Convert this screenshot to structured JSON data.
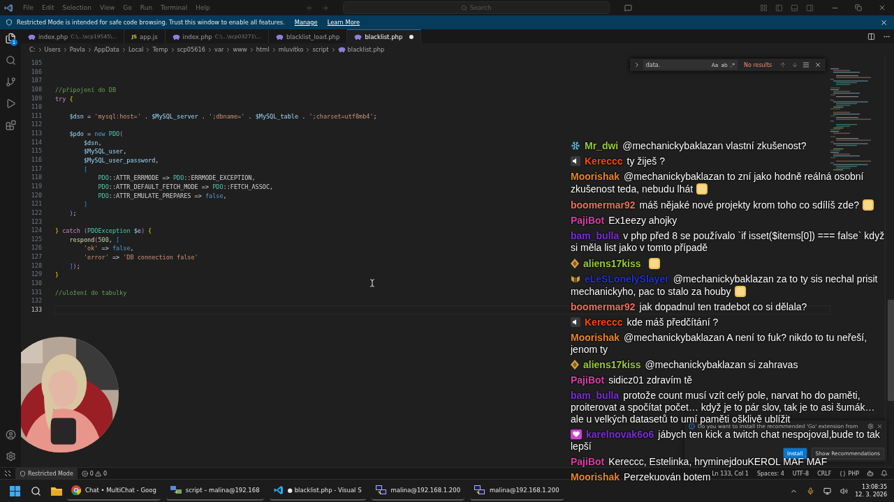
{
  "title_bar": {
    "menu": [
      "File",
      "Edit",
      "Selection",
      "View",
      "Go",
      "Run",
      "Terminal",
      "Help"
    ],
    "search": {
      "placeholder": "Search"
    }
  },
  "banner": {
    "text": "Restricted Mode is intended for safe code browsing. Trust this window to enable all features.",
    "links": [
      "Manage",
      "Learn More"
    ]
  },
  "activity_bar": {
    "explorer_badge": "1"
  },
  "tabs": [
    {
      "label": "index.php",
      "path": "C:\\...\\scp19545\\...",
      "kind": "php",
      "selected": false,
      "dirty": false
    },
    {
      "label": "app.js",
      "badge": "JS",
      "kind": "js",
      "selected": false,
      "dirty": false
    },
    {
      "label": "index.php",
      "path": "C:\\...\\scp03271\\...",
      "kind": "php",
      "selected": false,
      "dirty": false
    },
    {
      "label": "blacklist_load.php",
      "kind": "php",
      "selected": false,
      "dirty": false
    },
    {
      "label": "blacklist.php",
      "kind": "php",
      "selected": true,
      "dirty": true
    }
  ],
  "breadcrumbs": [
    "C:",
    "Users",
    "Pavla",
    "AppData",
    "Local",
    "Temp",
    "scp05616",
    "var",
    "www",
    "html",
    "mluvitko",
    "script",
    "blacklist.php"
  ],
  "editor": {
    "lines": [
      {
        "number": "105",
        "current": false
      },
      {
        "number": "106",
        "current": false
      },
      {
        "number": "107",
        "current": false
      },
      {
        "number": "108",
        "current": false,
        "tokens": [
          {
            "kind": "comment",
            "text": "//připojení do DB"
          }
        ]
      },
      {
        "number": "109",
        "current": false,
        "tokens": [
          {
            "kind": "keyword",
            "text": "try"
          },
          {
            "kind": "brace1",
            "text": " {"
          }
        ]
      },
      {
        "number": "110",
        "current": false
      },
      {
        "number": "111",
        "current": false,
        "tokens": [
          {
            "kind": "var",
            "text": "    $dsn"
          },
          {
            "kind": "op",
            "text": " = "
          },
          {
            "kind": "string",
            "text": "'mysql:host='"
          },
          {
            "kind": "op",
            "text": " . "
          },
          {
            "kind": "var",
            "text": "$MySQL_server"
          },
          {
            "kind": "op",
            "text": " . "
          },
          {
            "kind": "string",
            "text": "';dbname='"
          },
          {
            "kind": "op",
            "text": " . "
          },
          {
            "kind": "var",
            "text": "$MySQL_table"
          },
          {
            "kind": "op",
            "text": " . "
          },
          {
            "kind": "string",
            "text": "';charset=utf8mb4'"
          },
          {
            "kind": "op",
            "text": ";"
          }
        ]
      },
      {
        "number": "112",
        "current": false
      },
      {
        "number": "113",
        "current": false,
        "tokens": [
          {
            "kind": "var",
            "text": "    $pdo"
          },
          {
            "kind": "op",
            "text": " = "
          },
          {
            "kind": "storage",
            "text": "new"
          },
          {
            "kind": "class",
            "text": " PDO"
          },
          {
            "kind": "brace2",
            "text": "("
          }
        ]
      },
      {
        "number": "114",
        "current": false,
        "tokens": [
          {
            "kind": "var",
            "text": "        $dsn"
          },
          {
            "kind": "op",
            "text": ","
          }
        ]
      },
      {
        "number": "115",
        "current": false,
        "tokens": [
          {
            "kind": "var",
            "text": "        $MySQL_user"
          },
          {
            "kind": "op",
            "text": ","
          }
        ]
      },
      {
        "number": "116",
        "current": false,
        "tokens": [
          {
            "kind": "var",
            "text": "        $MySQL_user_password"
          },
          {
            "kind": "op",
            "text": ","
          }
        ]
      },
      {
        "number": "117",
        "current": false,
        "tokens": [
          {
            "kind": "brace3",
            "text": "        ["
          }
        ]
      },
      {
        "number": "118",
        "current": false,
        "tokens": [
          {
            "kind": "class",
            "text": "            PDO"
          },
          {
            "kind": "op",
            "text": "::ATTR_ERRMODE => "
          },
          {
            "kind": "class",
            "text": "PDO"
          },
          {
            "kind": "op",
            "text": "::ERRMODE_EXCEPTION,"
          }
        ]
      },
      {
        "number": "119",
        "current": false,
        "tokens": [
          {
            "kind": "class",
            "text": "            PDO"
          },
          {
            "kind": "op",
            "text": "::ATTR_DEFAULT_FETCH_MODE => "
          },
          {
            "kind": "class",
            "text": "PDO"
          },
          {
            "kind": "op",
            "text": "::FETCH_ASSOC,"
          }
        ]
      },
      {
        "number": "120",
        "current": false,
        "tokens": [
          {
            "kind": "class",
            "text": "            PDO"
          },
          {
            "kind": "op",
            "text": "::ATTR_EMULATE_PREPARES => "
          },
          {
            "kind": "storage",
            "text": "false"
          },
          {
            "kind": "op",
            "text": ","
          }
        ]
      },
      {
        "number": "121",
        "current": false,
        "tokens": [
          {
            "kind": "brace3",
            "text": "        ]"
          }
        ]
      },
      {
        "number": "122",
        "current": false,
        "tokens": [
          {
            "kind": "brace2",
            "text": "    )"
          },
          {
            "kind": "op",
            "text": ";"
          }
        ]
      },
      {
        "number": "123",
        "current": false
      },
      {
        "number": "124",
        "current": false,
        "tokens": [
          {
            "kind": "brace1",
            "text": "}"
          },
          {
            "kind": "keyword",
            "text": " catch"
          },
          {
            "kind": "brace2",
            "text": " ("
          },
          {
            "kind": "class",
            "text": "PDOException"
          },
          {
            "kind": "var",
            "text": " $e"
          },
          {
            "kind": "brace2",
            "text": ")"
          },
          {
            "kind": "brace1",
            "text": " {"
          }
        ]
      },
      {
        "number": "125",
        "current": false,
        "tokens": [
          {
            "kind": "fn",
            "text": "    respond"
          },
          {
            "kind": "brace2",
            "text": "("
          },
          {
            "kind": "num",
            "text": "500"
          },
          {
            "kind": "op",
            "text": ", "
          },
          {
            "kind": "brace3",
            "text": "["
          }
        ]
      },
      {
        "number": "126",
        "current": false,
        "tokens": [
          {
            "kind": "string",
            "text": "        'ok'"
          },
          {
            "kind": "op",
            "text": " => "
          },
          {
            "kind": "storage",
            "text": "false"
          },
          {
            "kind": "op",
            "text": ","
          }
        ]
      },
      {
        "number": "127",
        "current": false,
        "tokens": [
          {
            "kind": "string",
            "text": "        'error'"
          },
          {
            "kind": "op",
            "text": " => "
          },
          {
            "kind": "string",
            "text": "'DB connection false'"
          }
        ]
      },
      {
        "number": "128",
        "current": false,
        "tokens": [
          {
            "kind": "brace3",
            "text": "    ]"
          },
          {
            "kind": "brace2",
            "text": ")"
          },
          {
            "kind": "op",
            "text": ";"
          }
        ]
      },
      {
        "number": "129",
        "current": false,
        "tokens": [
          {
            "kind": "brace1",
            "text": "}"
          }
        ]
      },
      {
        "number": "130",
        "current": false
      },
      {
        "number": "131",
        "current": false,
        "tokens": [
          {
            "kind": "comment",
            "text": "//uložení do tabulky"
          }
        ]
      },
      {
        "number": "132",
        "current": false
      },
      {
        "number": "133",
        "current": true
      }
    ]
  },
  "find": {
    "value": "data.",
    "options": [
      "Aa",
      "ab",
      ".*"
    ],
    "result": "No results"
  },
  "chat": [
    {
      "kind": "snowflake",
      "user": "Mr_dwi",
      "color": "#9acd32",
      "lines": [
        "@mechanickybaklazan vlastní zkušenost?"
      ],
      "emote": false
    },
    {
      "kind": "speaker",
      "user": "Kereccc",
      "color": "#ff4500",
      "lines": [
        "ty žiješ ?"
      ],
      "emote": false
    },
    {
      "kind": "plain",
      "user": "Moorishak",
      "color": "#e8871e",
      "lines": [
        "@mechanickybaklazan to zní jako hodně reálná osobní",
        "zkušenost teda, nebudu lhát"
      ],
      "emote": true
    },
    {
      "kind": "plain",
      "user": "boomermar92",
      "color": "#e9715e",
      "lines": [
        "máš nějaké nové projekty krom toho co sdílíš zde?"
      ],
      "emote": true
    },
    {
      "kind": "plain",
      "user": "PajiBot",
      "color": "#d63fa4",
      "lines": [
        "Ex1eezy ahojky"
      ],
      "emote": false
    },
    {
      "kind": "plain",
      "user": "bam_bulla",
      "color": "#7b2fd6",
      "lines": [
        "v php před 8 se používalo `if isset($items[0]) === false` když",
        "si měla list jako v tomto případě"
      ],
      "emote": false
    },
    {
      "kind": "gem",
      "user": "aliens17kiss",
      "color": "#9acd32",
      "emote": true
    },
    {
      "kind": "wings",
      "user": "eLeSLonelySlayer",
      "color": "#2233cc",
      "lines": [
        "@mechanickybaklazan za to ty sis nechal prisit",
        "mechanickyho, pac to stalo za houby"
      ],
      "emote": true
    },
    {
      "kind": "plain",
      "user": "boomermar92",
      "color": "#e9715e",
      "lines": [
        "jak dopadnul ten tradebot co si dělala?"
      ],
      "emote": false
    },
    {
      "kind": "speaker",
      "user": "Kereccc",
      "color": "#ff4500",
      "lines": [
        "kde máš předčítání ?"
      ],
      "emote": false
    },
    {
      "kind": "plain",
      "user": "Moorishak",
      "color": "#e8871e",
      "lines": [
        "@mechanickybaklazan A není to fuk? nikdo to tu neřeší,",
        "jenom ty"
      ],
      "emote": false
    },
    {
      "kind": "gem",
      "user": "aliens17kiss",
      "color": "#9acd32",
      "lines": [
        "@mechanickybaklazan si zahravas"
      ],
      "emote": false
    },
    {
      "kind": "plain",
      "user": "PajiBot",
      "color": "#d63fa4",
      "lines": [
        "sidicz01 zdravím tě"
      ],
      "emote": false
    },
    {
      "kind": "plain",
      "user": "bam_bulla",
      "color": "#7b2fd6",
      "lines": [
        "protože count musí vzít celý pole, narvat ho do paměti,",
        "proiterovat a spočítat počet… když je to pár slov, tak je to asi šumák…",
        "ale u velkých datasetů to umí paměti ošklivě ublížit"
      ],
      "emote": false
    },
    {
      "kind": "heart",
      "user": "karelnovak6o6",
      "color": "#7b2fd6",
      "lines": [
        "jábych ten kick a twitch chat nespojoval,bude to tak",
        "lepší"
      ],
      "emote": false
    },
    {
      "kind": "plain",
      "user": "PajiBot",
      "color": "#d63fa4",
      "lines": [
        "Kereccc, Estelinka, hryminejdouKEROL MAF MAF"
      ],
      "emote": false
    },
    {
      "kind": "plain",
      "user": "Moorishak",
      "color": "#e8871e",
      "lines": [
        "Perzekuován botem"
      ],
      "emote": false
    }
  ],
  "notification": {
    "message": "Do you want to install the recommended 'Go' extension from",
    "buttons": [
      "Install",
      "Show Recommendations"
    ]
  },
  "status_bar": {
    "mode": "Restricted Mode",
    "errors": "0",
    "warnings": "0",
    "items": [
      "Ln 133, Col 1",
      "Spaces: 4",
      "UTF-8",
      "CRLF"
    ],
    "language": "PHP"
  },
  "taskbar": {
    "apps": [
      {
        "kind": "chrome",
        "label": "Chat • MultiChat - Goog"
      },
      {
        "kind": "winscp",
        "label": "script – malina@192.168"
      },
      {
        "kind": "vscode",
        "label": "● blacklist.php - Visual S"
      },
      {
        "kind": "putty",
        "label": "malina@192.168.1.200"
      },
      {
        "kind": "putty",
        "label": "malina@192.168.1.200"
      }
    ],
    "time": "13:08:35",
    "date": "12. 3. 2026"
  }
}
